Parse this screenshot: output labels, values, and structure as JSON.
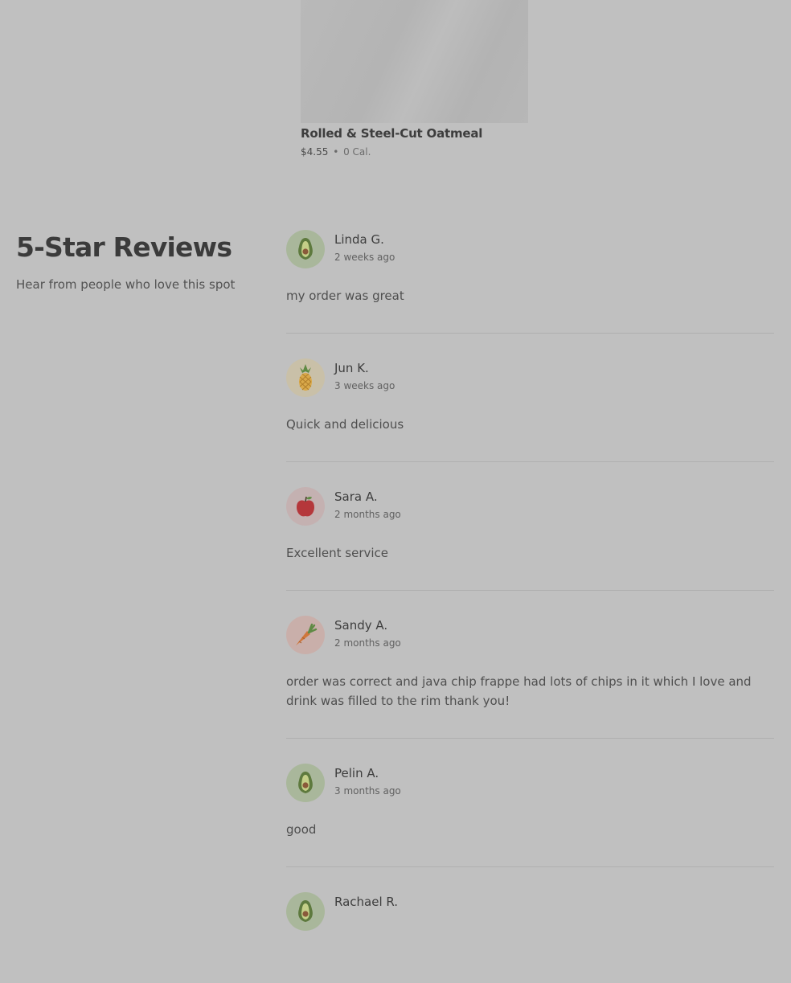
{
  "menu_item": {
    "name": "Rolled & Steel-Cut Oatmeal",
    "price": "$4.55",
    "separator": "•",
    "calories": "0 Cal."
  },
  "reviews_section": {
    "title": "5-Star Reviews",
    "subtitle": "Hear from people who love this spot"
  },
  "reviews": [
    {
      "name": "Linda G.",
      "time": "2 weeks ago",
      "text": "my order was great",
      "avatar_icon": "avocado-icon",
      "avatar_bg": "#a9b79b"
    },
    {
      "name": "Jun K.",
      "time": "3 weeks ago",
      "text": "Quick and delicious",
      "avatar_icon": "pineapple-icon",
      "avatar_bg": "#c9c0a8"
    },
    {
      "name": "Sara A.",
      "time": "2 months ago",
      "text": "Excellent service",
      "avatar_icon": "apple-icon",
      "avatar_bg": "#c4b1b1"
    },
    {
      "name": "Sandy A.",
      "time": "2 months ago",
      "text": "order was correct and java chip frappe had lots of chips in it which I love and drink was filled to the rim thank you!",
      "avatar_icon": "carrot-icon",
      "avatar_bg": "#c9afaa"
    },
    {
      "name": "Pelin A.",
      "time": "3 months ago",
      "text": "good",
      "avatar_icon": "avocado-icon",
      "avatar_bg": "#a9b79b"
    },
    {
      "name": "Rachael R.",
      "time": "",
      "text": "",
      "avatar_icon": "avocado-icon",
      "avatar_bg": "#a9b79b"
    }
  ]
}
